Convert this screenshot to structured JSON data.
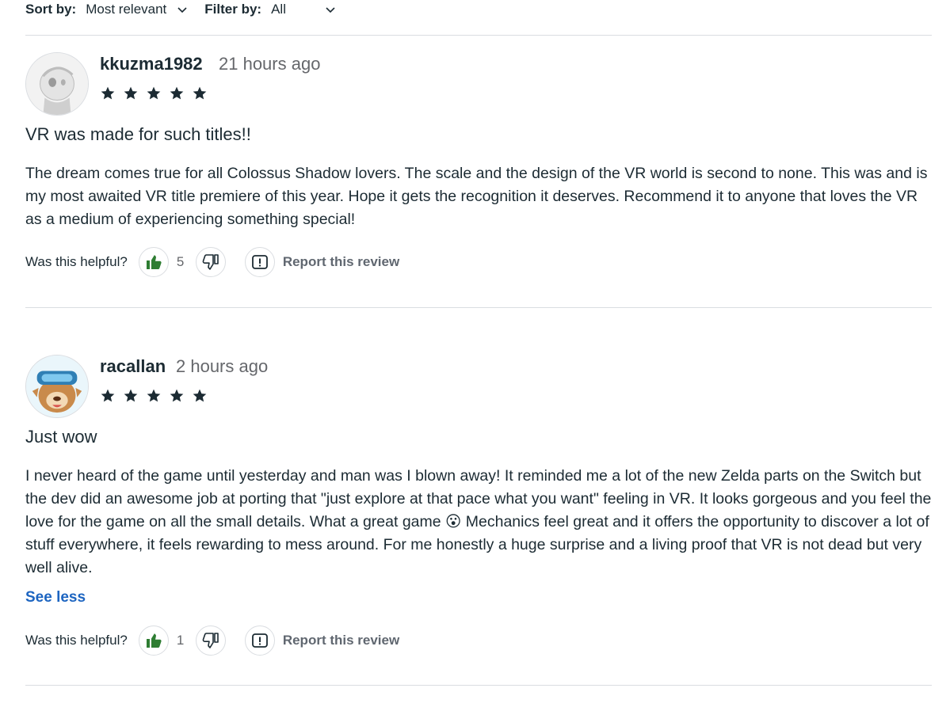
{
  "toolbar": {
    "sort_label": "Sort by:",
    "sort_value": "Most relevant",
    "filter_label": "Filter by:",
    "filter_value": "All"
  },
  "reviews": [
    {
      "username": "kkuzma1982",
      "time": "21 hours ago",
      "rating": 5,
      "title": "VR was made for such titles!!",
      "body": "The dream comes true for all Colossus Shadow lovers. The scale and the design of the VR world is second to none. This was and is my most awaited VR title premiere of this year. Hope it gets the recognition it deserves. Recommend it to anyone that loves the VR as a medium of experiencing something special!",
      "helpful_question": "Was this helpful?",
      "helpful_count": "5",
      "report_label": "Report this review"
    },
    {
      "username": "racallan",
      "time": "2 hours ago",
      "rating": 5,
      "title": "Just wow",
      "body": "I never heard of the game until yesterday and man was I blown away! It reminded me a lot of the new Zelda parts on the Switch but the dev did an awesome job at porting that \"just explore at that pace what you want\" feeling in VR. It looks gorgeous and you feel the love for the game on all the small details. What a great game 😮 Mechanics feel great and it offers the opportunity to discover a lot of stuff everywhere, it feels rewarding to mess around. For me honestly a huge surprise and a living proof that VR is not dead but very well alive.",
      "see_less": "See less",
      "helpful_question": "Was this helpful?",
      "helpful_count": "1",
      "report_label": "Report this review"
    }
  ],
  "colors": {
    "text": "#1c2b33",
    "muted": "#65676b",
    "link": "#1d65c1",
    "thumbs_up": "#2e7d32",
    "divider": "#dadde1"
  },
  "icons": [
    "chevron-down-icon",
    "star-icon",
    "thumbs-up-icon",
    "thumbs-down-icon",
    "report-icon"
  ]
}
